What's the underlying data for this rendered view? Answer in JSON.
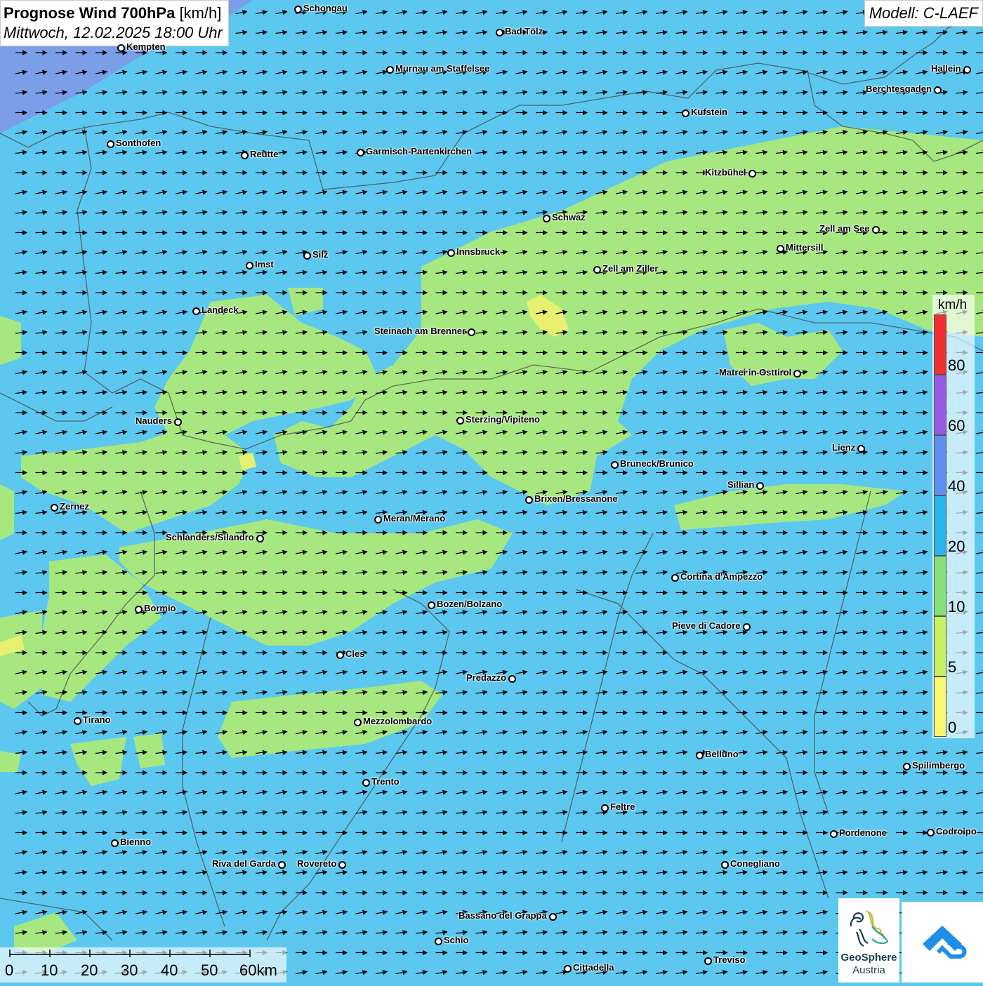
{
  "header": {
    "title_bold": "Prognose Wind 700hPa",
    "title_unit": "[km/h]",
    "datetime": "Mittwoch, 12.02.2025 18:00 Uhr",
    "model": "Modell: C-LAEF"
  },
  "legend": {
    "unit": "km/h",
    "labels": [
      "80",
      "60",
      "40",
      "20",
      "10",
      "5",
      "0"
    ],
    "colors": [
      "#f03030",
      "#9a5ae8",
      "#5f8ff0",
      "#28b5ec",
      "#86e07a",
      "#c8f060",
      "#f8f870"
    ]
  },
  "scalebar": {
    "labels": [
      "0",
      "10",
      "20",
      "30",
      "40",
      "50",
      "60km"
    ]
  },
  "logo": {
    "name": "GeoSphere",
    "sub": "Austria"
  },
  "colors": {
    "sea_blue": "#5cc8f0",
    "green": "#a6e87f",
    "yellow": "#e8f070",
    "purple": "#7a8ee8"
  },
  "cities": [
    {
      "name": "Schongau"
    },
    {
      "name": "Bad Tölz"
    },
    {
      "name": "Kempten"
    },
    {
      "name": "Murnau am Staffelsee"
    },
    {
      "name": "Hallein"
    },
    {
      "name": "Berchtesgaden"
    },
    {
      "name": "Kufstein"
    },
    {
      "name": "Sonthofen"
    },
    {
      "name": "Reutte"
    },
    {
      "name": "Garmisch-Partenkirchen"
    },
    {
      "name": "Kitzbühel"
    },
    {
      "name": "Schwaz"
    },
    {
      "name": "Zell am See"
    },
    {
      "name": "Mittersill"
    },
    {
      "name": "Innsbruck"
    },
    {
      "name": "Silz"
    },
    {
      "name": "Imst"
    },
    {
      "name": "Zell am Ziller"
    },
    {
      "name": "Landeck"
    },
    {
      "name": "Steinach am Brenner"
    },
    {
      "name": "Matrei in Osttirol"
    },
    {
      "name": "Nauders"
    },
    {
      "name": "Sterzing/Vipiteno"
    },
    {
      "name": "Lienz"
    },
    {
      "name": "Bruneck/Brunico"
    },
    {
      "name": "Sillian"
    },
    {
      "name": "Brixen/Bressanone"
    },
    {
      "name": "Zernez"
    },
    {
      "name": "Meran/Merano"
    },
    {
      "name": "Schlanders/Silandro"
    },
    {
      "name": "Cortina d'Ampezzo"
    },
    {
      "name": "Bozen/Bolzano"
    },
    {
      "name": "Bormio"
    },
    {
      "name": "Pieve di Cadore"
    },
    {
      "name": "Cles"
    },
    {
      "name": "Predazzo"
    },
    {
      "name": "Tirano"
    },
    {
      "name": "Mezzolombardo"
    },
    {
      "name": "Belluno"
    },
    {
      "name": "Spilimbergo"
    },
    {
      "name": "Trento"
    },
    {
      "name": "Feltre"
    },
    {
      "name": "Pordenone"
    },
    {
      "name": "Codroipo"
    },
    {
      "name": "Bienno"
    },
    {
      "name": "Riva del Garda"
    },
    {
      "name": "Rovereto"
    },
    {
      "name": "Conegliano"
    },
    {
      "name": "Bassano del Grappa"
    },
    {
      "name": "Schio"
    },
    {
      "name": "Treviso"
    },
    {
      "name": "Cittadella"
    }
  ]
}
